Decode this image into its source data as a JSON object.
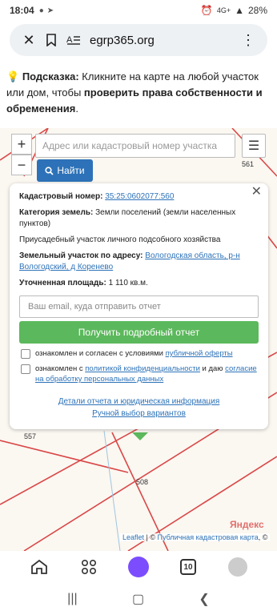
{
  "status": {
    "time": "18:04",
    "battery": "28%",
    "network": "4G+"
  },
  "toolbar": {
    "url": "egrp365.org"
  },
  "hint": {
    "label": "Подсказка:",
    "text1": " Кликните на карте на любой участок или дом, чтобы ",
    "bold": "проверить права собственности и обременения",
    "end": "."
  },
  "map": {
    "search_placeholder": "Адрес или кадастровый номер участка",
    "find_label": "Найти",
    "zoom_in": "+",
    "zoom_out": "−",
    "parcel_labels": [
      "561",
      "557",
      "508"
    ],
    "attribution_leaflet": "Leaflet",
    "attribution_sep": " | © ",
    "attribution_pkk": "Публичная кадастровая карта",
    "attribution_end": ", ©",
    "yandex": "Яндекс"
  },
  "popup": {
    "cad_label": "Кадастровый номер:",
    "cad_value": "35:25:0602077:560",
    "category_label": "Категория земель:",
    "category_value": "Земли поселений (земли населенных пунктов)",
    "usage": "Приусадебный участок личного подсобного хозяйства",
    "address_label": "Земельный участок по адресу:",
    "address_value": "Вологодская область, р-н Вологодский, д Коренево",
    "area_label": "Уточненная площадь:",
    "area_value": "1 110 кв.м.",
    "email_placeholder": "Ваш email, куда отправить отчет",
    "report_button": "Получить подробный отчет",
    "agree1_text": "ознакомлен и согласен с условиями ",
    "agree1_link": "публичной оферты",
    "agree2_text": "ознакомлен с ",
    "agree2_link1": "политикой конфиденциальности",
    "agree2_mid": " и даю ",
    "agree2_link2": "согласие на обработку персональных данных",
    "link_details": "Детали отчета и юридическая информация",
    "link_manual": "Ручной выбор вариантов"
  },
  "bottombar": {
    "tabs_count": "10"
  },
  "colors": {
    "accent_blue": "#2d72b8",
    "green": "#5cb85c",
    "map_line": "#d94848"
  }
}
